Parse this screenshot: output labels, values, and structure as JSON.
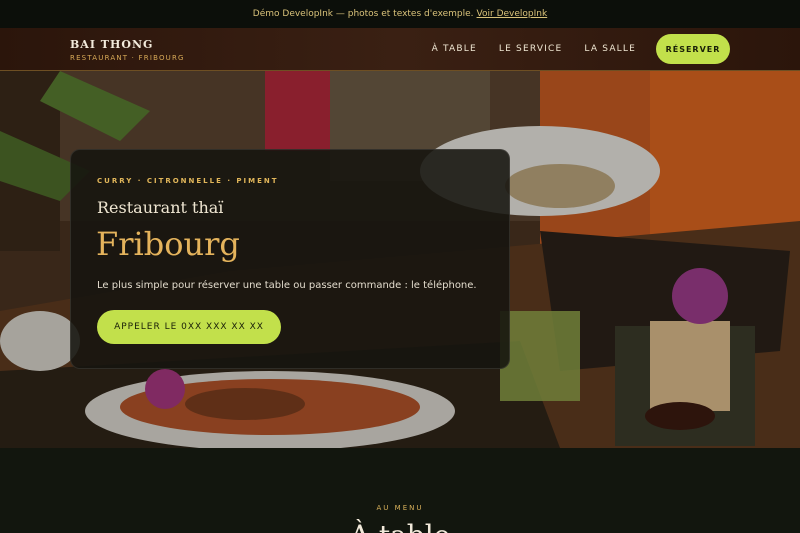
{
  "demo_bar": {
    "text": "Démo DevelopInk — photos et textes d'exemple.",
    "link": "Voir DevelopInk"
  },
  "header": {
    "brand_name": "BAI THONG",
    "brand_sub": "RESTAURANT · FRIBOURG",
    "nav": [
      "À TABLE",
      "LE SERVICE",
      "LA SALLE"
    ],
    "cta": "RÉSERVER"
  },
  "hero": {
    "eyebrow": "CURRY · CITRONNELLE · PIMENT",
    "kicker": "Restaurant thaï",
    "city": "Fribourg",
    "lead": "Le plus simple pour réserver une table ou passer commande : le téléphone.",
    "call": "APPELER LE 0XX XXX XX XX"
  },
  "section": {
    "label": "AU MENU",
    "heading": "À table"
  },
  "colors": {
    "accent": "#c2e04b",
    "gold": "#e4b35c",
    "dark": "#0e110b"
  }
}
